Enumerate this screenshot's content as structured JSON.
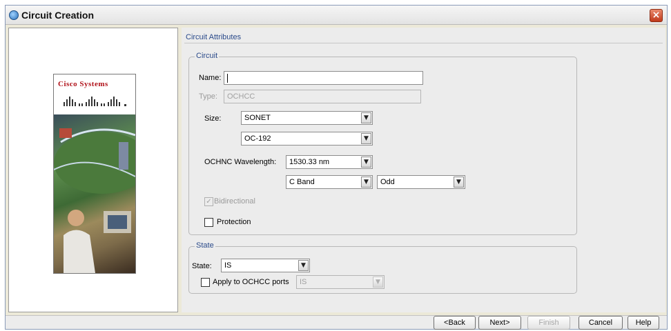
{
  "window": {
    "title": "Circuit Creation",
    "close_glyph": "×"
  },
  "sidebar": {
    "logo_text": "Cisco Systems"
  },
  "section": {
    "title": "Circuit Attributes"
  },
  "circuit": {
    "legend": "Circuit",
    "name_label": "Name:",
    "name_value": "",
    "type_label": "Type:",
    "type_value": "OCHCC",
    "size_label": "Size:",
    "size_value": "SONET",
    "rate_value": "OC-192",
    "wavelength_label": "OCHNC Wavelength:",
    "wavelength_value": "1530.33 nm",
    "band_value": "C Band",
    "parity_value": "Odd",
    "bidirectional_label": "Bidirectional",
    "bidirectional_checked": true,
    "protection_label": "Protection",
    "protection_checked": false
  },
  "state": {
    "legend": "State",
    "state_label": "State:",
    "state_value": "IS",
    "apply_label": "Apply to OCHCC ports",
    "apply_checked": false,
    "apply_value": "IS"
  },
  "buttons": {
    "back": "<Back",
    "next": "Next>",
    "finish": "Finish",
    "cancel": "Cancel",
    "help": "Help"
  },
  "icons": {
    "dropdown_glyph": "▼",
    "check_glyph": "✓"
  }
}
